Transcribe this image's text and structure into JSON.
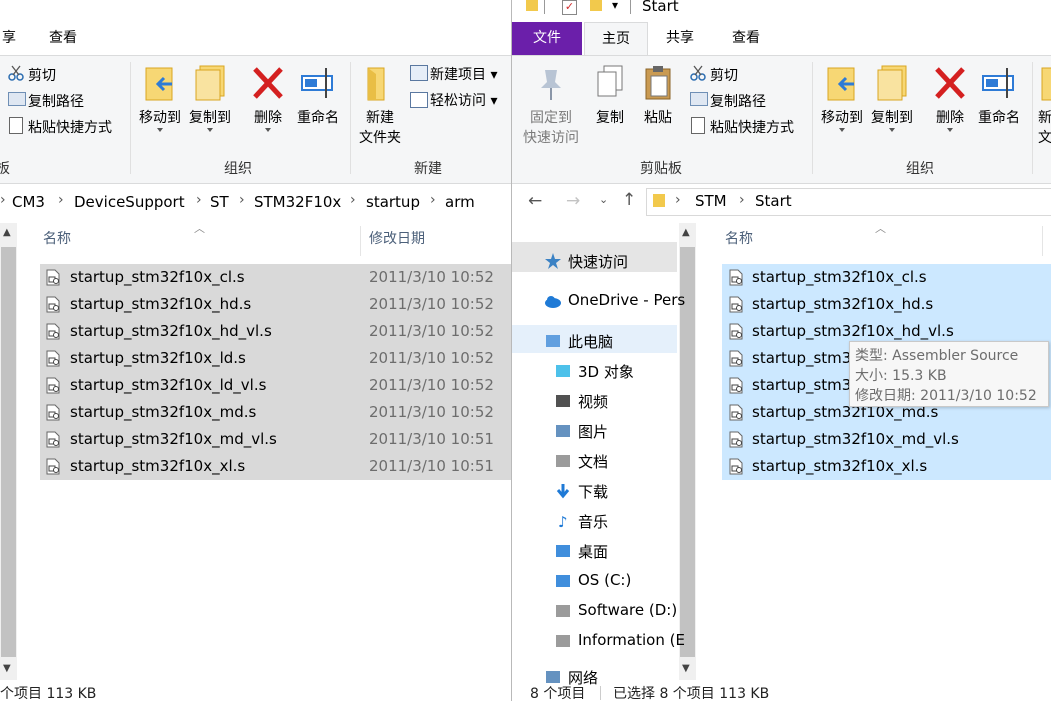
{
  "left": {
    "tabs": {
      "share_partial": "享",
      "view": "查看"
    },
    "ribbon": {
      "cut": "剪切",
      "copy_path": "复制路径",
      "paste_shortcut": "粘贴快捷方式",
      "move_to": "移动到",
      "copy_to": "复制到",
      "delete": "删除",
      "rename": "重命名",
      "new_folder_l1": "新建",
      "new_folder_l2": "文件夹",
      "new_item": "新建项目",
      "easy_access": "轻松访问",
      "group_organize": "组织",
      "group_new": "新建",
      "group_partial": "板"
    },
    "breadcrumb": [
      "CM3",
      "DeviceSupport",
      "ST",
      "STM32F10x",
      "startup",
      "arm"
    ],
    "columns": {
      "name": "名称",
      "date": "修改日期"
    },
    "files": [
      {
        "name": "startup_stm32f10x_cl.s",
        "date": "2011/3/10 10:52"
      },
      {
        "name": "startup_stm32f10x_hd.s",
        "date": "2011/3/10 10:52"
      },
      {
        "name": "startup_stm32f10x_hd_vl.s",
        "date": "2011/3/10 10:52"
      },
      {
        "name": "startup_stm32f10x_ld.s",
        "date": "2011/3/10 10:52"
      },
      {
        "name": "startup_stm32f10x_ld_vl.s",
        "date": "2011/3/10 10:52"
      },
      {
        "name": "startup_stm32f10x_md.s",
        "date": "2011/3/10 10:52"
      },
      {
        "name": "startup_stm32f10x_md_vl.s",
        "date": "2011/3/10 10:51"
      },
      {
        "name": "startup_stm32f10x_xl.s",
        "date": "2011/3/10 10:51"
      }
    ],
    "status": "个项目  113 KB"
  },
  "right": {
    "title": "Start",
    "tabs": {
      "file": "文件",
      "home": "主页",
      "share": "共享",
      "view": "查看"
    },
    "ribbon": {
      "pin_l1": "固定到",
      "pin_l2": "快速访问",
      "copy": "复制",
      "paste": "粘贴",
      "cut": "剪切",
      "copy_path": "复制路径",
      "paste_shortcut": "粘贴快捷方式",
      "move_to": "移动到",
      "copy_to": "复制到",
      "delete": "删除",
      "rename": "重命名",
      "new_partial_l1": "新",
      "new_partial_l2": "文",
      "group_clipboard": "剪贴板",
      "group_organize": "组织"
    },
    "breadcrumb": [
      "STM",
      "Start"
    ],
    "nav": [
      {
        "label": "快速访问",
        "icon": "star-icon"
      },
      {
        "label": "OneDrive - Pers",
        "icon": "cloud-icon"
      },
      {
        "label": "此电脑",
        "icon": "computer-icon"
      },
      {
        "label": "3D 对象",
        "icon": "cube-icon"
      },
      {
        "label": "视频",
        "icon": "video-icon"
      },
      {
        "label": "图片",
        "icon": "picture-icon"
      },
      {
        "label": "文档",
        "icon": "document-icon"
      },
      {
        "label": "下载",
        "icon": "download-icon"
      },
      {
        "label": "音乐",
        "icon": "music-icon"
      },
      {
        "label": "桌面",
        "icon": "desktop-icon"
      },
      {
        "label": "OS (C:)",
        "icon": "windows-drive-icon"
      },
      {
        "label": "Software (D:)",
        "icon": "drive-icon"
      },
      {
        "label": "Information (E",
        "icon": "drive-icon"
      },
      {
        "label": "网络",
        "icon": "network-icon"
      }
    ],
    "columns": {
      "name": "名称"
    },
    "files": [
      {
        "name": "startup_stm32f10x_cl.s"
      },
      {
        "name": "startup_stm32f10x_hd.s"
      },
      {
        "name": "startup_stm32f10x_hd_vl.s"
      },
      {
        "name": "startup_stm32f10x_ld.s"
      },
      {
        "name": "startup_stm32f10x_ld_vl.s"
      },
      {
        "name": "startup_stm32f10x_md.s"
      },
      {
        "name": "startup_stm32f10x_md_vl.s"
      },
      {
        "name": "startup_stm32f10x_xl.s"
      }
    ],
    "files_visible_partial": [
      "startup_stm32",
      "startup_stm32"
    ],
    "tooltip": {
      "type": "类型: Assembler Source",
      "size": "大小: 15.3 KB",
      "modified": "修改日期: 2011/3/10 10:52"
    },
    "status": {
      "count": "8 个项目",
      "selected": "已选择 8 个项目  113 KB"
    }
  },
  "colors": {
    "file_tab": "#6b1faa",
    "selection_left": "#d9d9d9",
    "selection_right": "#cce8ff",
    "ribbon_bg": "#f5f6f7"
  }
}
